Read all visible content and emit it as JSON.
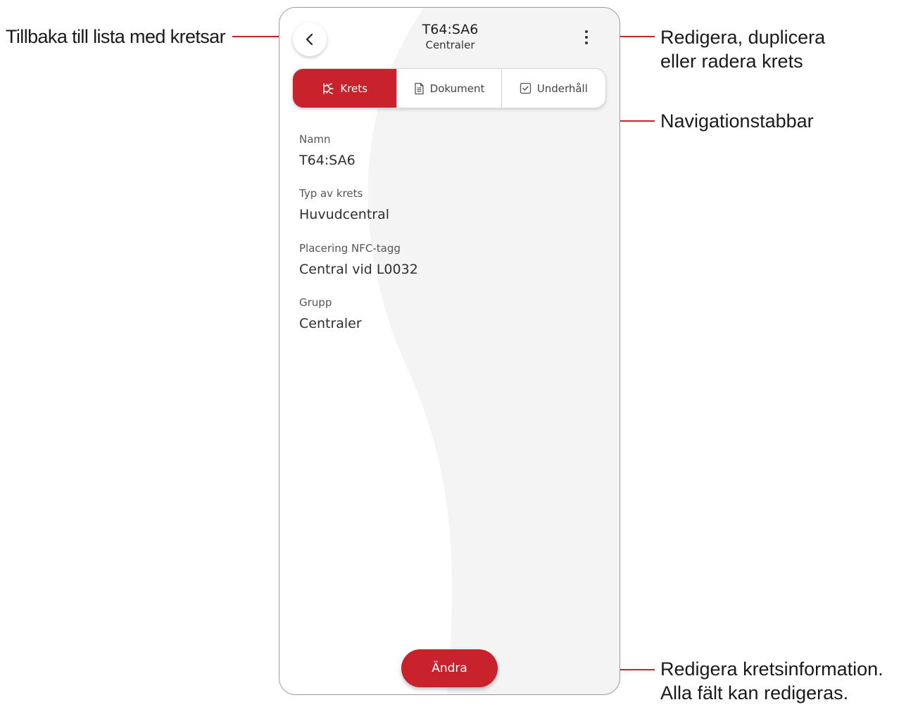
{
  "annotations": {
    "back": "Tillbaka till lista med kretsar",
    "menu_line1": "Redigera, duplicera",
    "menu_line2": "eller radera krets",
    "nav": "Navigationstabbar",
    "edit_line1": "Redigera kretsinformation.",
    "edit_line2": "Alla fält kan redigeras."
  },
  "header": {
    "title": "T64:SA6",
    "subtitle": "Centraler",
    "back_icon": "chevron-left-icon",
    "menu_icon": "more-vertical-icon"
  },
  "tabs": [
    {
      "label": "Krets",
      "icon": "circuit-icon",
      "active": true
    },
    {
      "label": "Dokument",
      "icon": "document-icon",
      "active": false
    },
    {
      "label": "Underhåll",
      "icon": "checkbox-icon",
      "active": false
    }
  ],
  "fields": [
    {
      "label": "Namn",
      "value": "T64:SA6"
    },
    {
      "label": "Typ av krets",
      "value": "Huvudcentral"
    },
    {
      "label": "Placering NFC-tagg",
      "value": "Central vid L0032"
    },
    {
      "label": "Grupp",
      "value": "Centraler"
    }
  ],
  "edit_button": "Ändra",
  "colors": {
    "accent": "#c8232c",
    "annotation_line": "#c8232c"
  }
}
